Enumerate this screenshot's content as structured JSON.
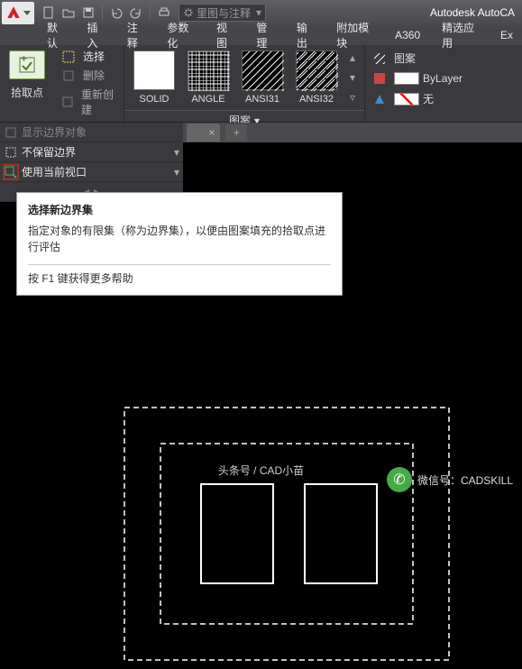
{
  "app": {
    "title": "Autodesk AutoCA",
    "search_placeholder": "里图与注释"
  },
  "menu": {
    "items": [
      "默认",
      "插入",
      "注释",
      "参数化",
      "视图",
      "管理",
      "输出",
      "附加模块",
      "A360",
      "精选应用",
      "Ex"
    ]
  },
  "ribbon": {
    "pick_label": "拾取点",
    "select": "选择",
    "delete": "删除",
    "recreate": "重新创建",
    "patterns": [
      {
        "name": "SOLID"
      },
      {
        "name": "ANGLE"
      },
      {
        "name": "ANSI31"
      },
      {
        "name": "ANSI32"
      }
    ],
    "group_label": "图案",
    "props": {
      "pattern": "图案",
      "bylayer": "ByLayer",
      "none": "无"
    }
  },
  "left_panel": {
    "show_boundary": "显示边界对象",
    "keep_boundary": "不保留边界",
    "use_viewport": "使用当前视口"
  },
  "doc_tab": {
    "close": "×",
    "add": "+"
  },
  "tooltip": {
    "title": "选择新边界集",
    "body": "指定对象的有限集（称为边界集），以便由图案填充的拾取点进行评估",
    "help": "按 F1 键获得更多帮助"
  },
  "watermark": {
    "text": "微信号：CADSKILL"
  },
  "credit": "头条号 / CAD小苗"
}
